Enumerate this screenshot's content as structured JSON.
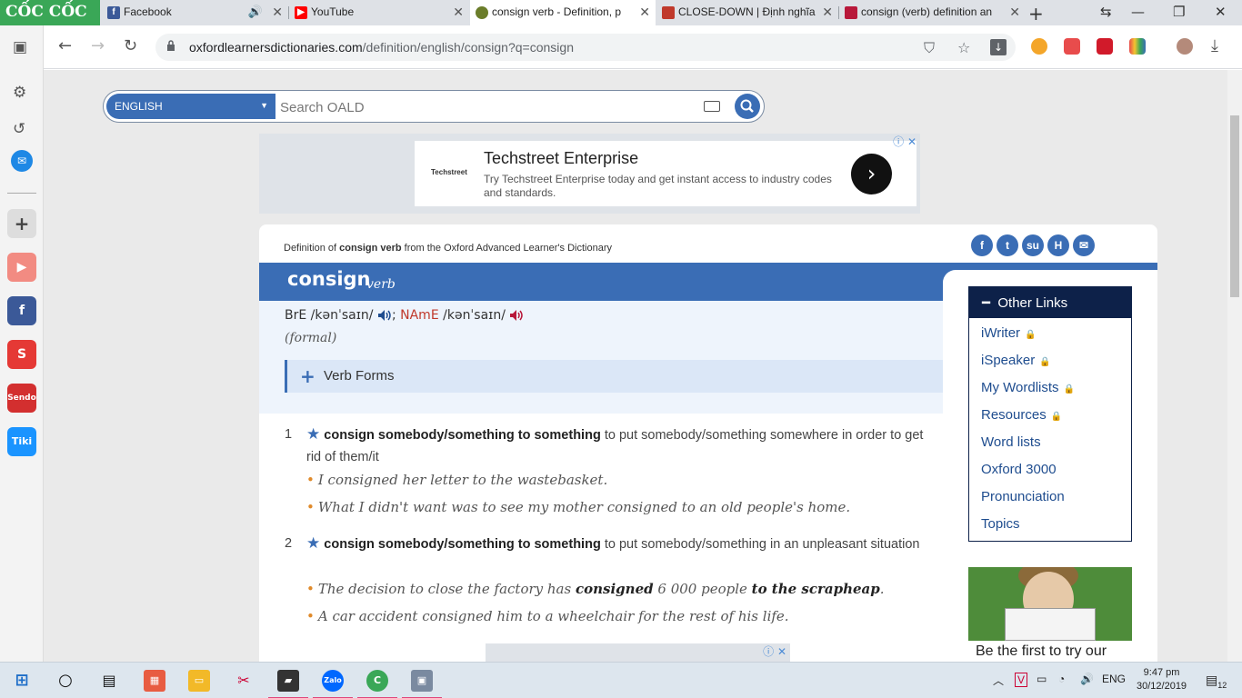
{
  "browser": {
    "logo_text": "CỐC CỐC",
    "tabs": [
      {
        "title": "Facebook",
        "icon": "facebook-icon",
        "color": "#3b5998"
      },
      {
        "title": "YouTube",
        "icon": "youtube-icon",
        "color": "#ff0000"
      },
      {
        "title": "consign verb - Definition, p",
        "icon": "oxford-icon",
        "color": "#6b7d2a"
      },
      {
        "title": "CLOSE-DOWN | Định nghĩa",
        "icon": "cambridge-icon",
        "color": "#c0392b"
      },
      {
        "title": "consign (verb) definition an",
        "icon": "macmillan-icon",
        "color": "#b8183a"
      }
    ],
    "url_host": "oxfordlearnersdictionaries.com",
    "url_path": "/definition/english/consign?q=consign"
  },
  "search": {
    "language": "ENGLISH",
    "placeholder": "Search OALD"
  },
  "ad": {
    "brand": "Techstreet",
    "title": "Techstreet Enterprise",
    "description": "Try Techstreet Enterprise today and get instant access to industry codes and standards."
  },
  "entry": {
    "source_prefix": "Definition of ",
    "source_word": "consign verb",
    "source_suffix": " from the Oxford Advanced Learner's Dictionary",
    "headword": "consign",
    "pos": "verb",
    "bre_label": "BrE",
    "bre_ipa": "/kənˈsaɪn/",
    "name_label": "NAmE",
    "name_ipa": "/kənˈsaɪn/",
    "register": "(formal)",
    "verb_forms_label": "Verb Forms",
    "senses": [
      {
        "num": "1",
        "pattern": "consign somebody/something to something",
        "definition": " to put somebody/something somewhere in order to get rid of them/it",
        "examples": [
          "I consigned her letter to the wastebasket.",
          "What I didn't want was to see my mother consigned to an old people's home."
        ]
      },
      {
        "num": "2",
        "pattern": "consign somebody/something to something",
        "definition": " to put somebody/something in an unpleasant situation",
        "examples": [
          {
            "pre": "The decision to close the factory has ",
            "b1": "consigned",
            "mid": " 6 000 people ",
            "b2": "to the scrapheap",
            "post": "."
          },
          "A car accident consigned him to a wheelchair for the rest of his life."
        ]
      }
    ]
  },
  "other_links": {
    "title": "Other Links",
    "items": [
      {
        "label": "iWriter",
        "locked": true
      },
      {
        "label": "iSpeaker",
        "locked": true
      },
      {
        "label": "My Wordlists",
        "locked": true
      },
      {
        "label": "Resources",
        "locked": true
      },
      {
        "label": "Word lists",
        "locked": false
      },
      {
        "label": "Oxford 3000",
        "locked": false
      },
      {
        "label": "Pronunciation",
        "locked": false
      },
      {
        "label": "Topics",
        "locked": false
      }
    ]
  },
  "promo_text": "Be the first to try our",
  "taskbar": {
    "lang": "ENG",
    "time": "9:47 pm",
    "date": "30/12/2019",
    "notifications": "12"
  },
  "colors": {
    "oald_blue": "#3a6db5",
    "navy": "#0d2149",
    "link": "#1f4d8f",
    "lock_red": "#b8183a"
  }
}
